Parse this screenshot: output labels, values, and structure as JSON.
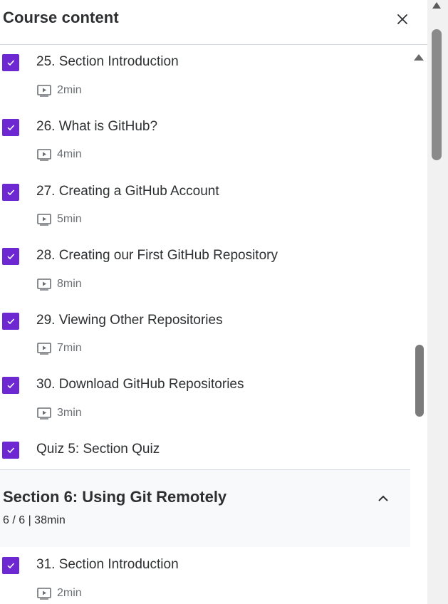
{
  "panel": {
    "title": "Course content"
  },
  "items": [
    {
      "title": "25. Section Introduction",
      "duration": "2min"
    },
    {
      "title": "26. What is GitHub?",
      "duration": "4min"
    },
    {
      "title": "27. Creating a GitHub Account",
      "duration": "5min"
    },
    {
      "title": "28. Creating our First GitHub Repository",
      "duration": "8min"
    },
    {
      "title": "29. Viewing Other Repositories",
      "duration": "7min"
    },
    {
      "title": "30. Download GitHub Repositories",
      "duration": "3min"
    },
    {
      "title": "Quiz 5: Section Quiz"
    }
  ],
  "section": {
    "title": "Section 6: Using Git Remotely",
    "meta": "6 / 6 | 38min"
  },
  "section_items": [
    {
      "title": "31. Section Introduction",
      "duration": "2min"
    }
  ],
  "colors": {
    "accent": "#6d28d2",
    "text": "#2d2f31",
    "muted": "#6a6f73",
    "section_bg": "#f7f9fa"
  },
  "icons": {
    "close": "close-icon",
    "check": "check-icon",
    "video": "video-play-icon",
    "chevron": "chevron-up-icon"
  }
}
